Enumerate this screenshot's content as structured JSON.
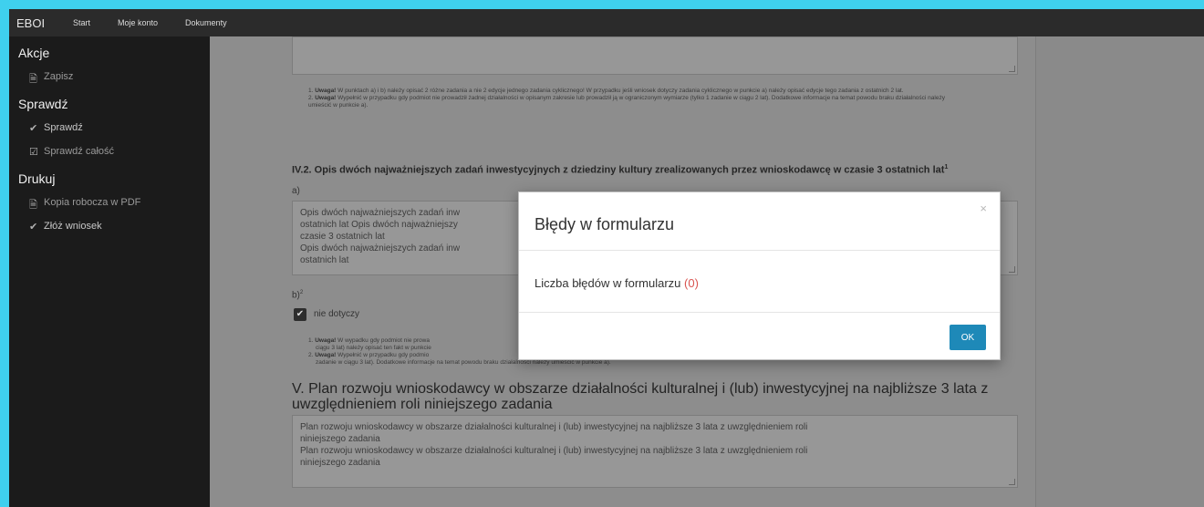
{
  "navbar": {
    "brand": "EBOI",
    "links": [
      "Start",
      "Moje konto",
      "Dokumenty"
    ]
  },
  "sidebar": {
    "sections": [
      {
        "title": "Akcje",
        "items": [
          {
            "label": "Zapisz",
            "icon": "document-icon"
          }
        ]
      },
      {
        "title": "Sprawdź",
        "items": [
          {
            "label": "Sprawdź",
            "icon": "check-icon"
          },
          {
            "label": "Sprawdź całość",
            "icon": "check-square-icon"
          }
        ]
      },
      {
        "title": "Drukuj",
        "items": [
          {
            "label": "Kopia robocza w PDF",
            "icon": "pdf-icon"
          },
          {
            "label": "Złóż wniosek",
            "icon": "check-circle-icon"
          }
        ]
      }
    ]
  },
  "form": {
    "notes_top": {
      "n1_bold": "Uwaga!",
      "n1": "W punktach a) i b) należy opisać 2 różne zadania a nie 2 edycje jednego zadania cyklicznego! W przypadku jeśli wniosek dotyczy zadania cyklicznego w punkcie a) należy opisać edycje tego zadania z ostatnich 2 lat.",
      "n2_bold": "Uwaga!",
      "n2": "Wypełnić w przypadku gdy podmiot nie prowadził żadnej działalności w opisanym zakresie lub prowadził ją w ograniczonym wymiarze (tylko 1 zadanie w ciągu 2 lat). Dodatkowe informacje na temat powodu braku działalności należy umieścić w punkcie a)."
    },
    "section_iv2": {
      "title": "IV.2. Opis dwóch najważniejszych zadań inwestycyjnych z dziedziny kultury zrealizowanych przez wnioskodawcę w czasie 3 ostatnich lat",
      "sup": "1",
      "a_label": "a)",
      "a_value_l1": "Opis dwóch najważniejszych zadań inw",
      "a_value_l2": "ostatnich lat Opis dwóch najważniejszy",
      "a_value_l3": "czasie 3 ostatnich lat",
      "a_value_l4": "Opis dwóch najważniejszych zadań inw",
      "a_value_l5": "ostatnich lat",
      "b_label": "b)",
      "b_sup": "2",
      "checkbox_label": "nie dotyczy"
    },
    "notes_mid": {
      "n1_bold": "Uwaga!",
      "n1a": "W wypadku gdy podmiot nie prowa",
      "n1b": "ciągu 3 lat) należy opisać ten fakt w punkcie",
      "n2_bold": "Uwaga!",
      "n2a": "Wypełnić w przypadku gdy podmio",
      "n2b": "zadanie w ciągu 3 lat). Dodatkowe informacje na temat powodu braku działalności należy umieścić w punkcie a)."
    },
    "section_v": {
      "title": "V. Plan rozwoju wnioskodawcy w obszarze działalności kulturalnej i (lub) inwestycyjnej na najbliższe 3 lata z uwzględnieniem roli niniejszego zadania",
      "value_l1": "Plan rozwoju wnioskodawcy w obszarze działalności kulturalnej i (lub) inwestycyjnej na najbliższe 3 lata z uwzględnieniem roli",
      "value_l2": "niniejszego zadania",
      "value_l3": "Plan rozwoju wnioskodawcy w obszarze działalności kulturalnej i (lub) inwestycyjnej na najbliższe 3 lata z uwzględnieniem roli",
      "value_l4": "niniejszego zadania"
    }
  },
  "modal": {
    "title": "Błędy w formularzu",
    "close": "×",
    "body_text": "Liczba błędów w formularzu",
    "error_count": "(0)",
    "ok_label": "OK"
  },
  "colors": {
    "accent": "#1e89b8",
    "error": "#d9534f",
    "screen_border": "#3fd0ee"
  }
}
